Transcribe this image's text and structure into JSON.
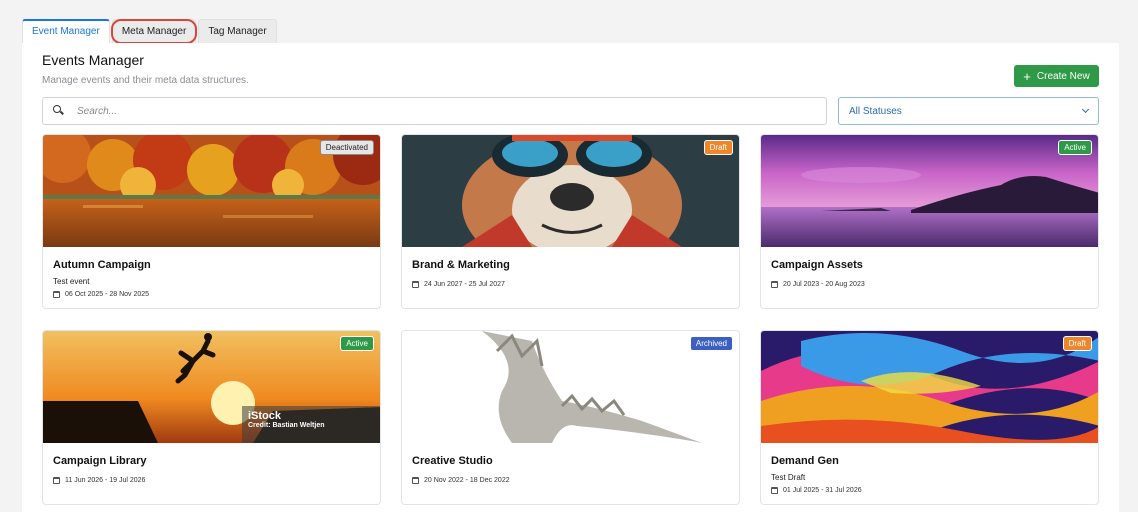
{
  "tabs": [
    {
      "label": "Event Manager"
    },
    {
      "label": "Meta Manager"
    },
    {
      "label": "Tag Manager"
    }
  ],
  "header": {
    "title": "Events Manager",
    "subtitle": "Manage events and their meta data structures.",
    "create_label": "Create New"
  },
  "search": {
    "placeholder": "Search...",
    "value": ""
  },
  "status_filter": {
    "selected": "All Statuses"
  },
  "colors": {
    "accent": "#1a73e8",
    "create_button": "#2e9a47",
    "badge_active": "#2e9a47",
    "badge_draft": "#f0862a",
    "badge_archived": "#3c5fc4",
    "highlight_ring": "#d9463a"
  },
  "events": [
    {
      "name": "Autumn Campaign",
      "description": "Test event",
      "dates": "06 Oct 2025 - 28 Nov 2025",
      "status": "Deactivated",
      "image": "autumn lake forest"
    },
    {
      "name": "Brand & Marketing",
      "description": "",
      "dates": "24 Jun 2027 - 25 Jul 2027",
      "status": "Draft",
      "image": "bulldog with goggles"
    },
    {
      "name": "Campaign Assets",
      "description": "",
      "dates": "20 Jul 2023 - 20 Aug 2023",
      "status": "Active",
      "image": "purple sunset island"
    },
    {
      "name": "Campaign Library",
      "description": "",
      "dates": "11 Jun 2026 - 19 Jul 2026",
      "status": "Active",
      "image": "silhouette jumping cliff sunset",
      "watermark": {
        "logo": "iStock",
        "credit": "Credit: Bastian Weltjen"
      }
    },
    {
      "name": "Creative Studio",
      "description": "",
      "dates": "20 Nov 2022 - 18 Dec 2022",
      "status": "Archived",
      "image": "white dragon sculpture"
    },
    {
      "name": "Demand Gen",
      "description": "Test Draft",
      "dates": "01 Jul 2025 - 31 Jul 2026",
      "status": "Draft",
      "image": "colorful abstract waves"
    }
  ]
}
